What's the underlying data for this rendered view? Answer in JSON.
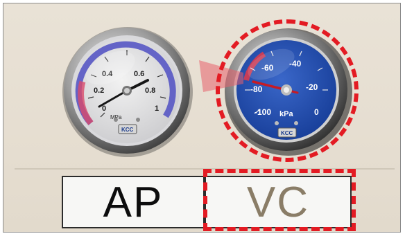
{
  "gauge_ap": {
    "unit": "MPa",
    "scale_labels": [
      "0",
      "0.2",
      "0.4",
      "0.6",
      "0.8",
      "1"
    ],
    "brand": "KCC"
  },
  "gauge_vc": {
    "unit": "kPa",
    "scale_labels": [
      "-100",
      "-80",
      "-60",
      "-40",
      "-20",
      "0"
    ],
    "brand": "KCC"
  },
  "labels": {
    "ap": "AP",
    "vc": "VC"
  },
  "colors": {
    "highlight": "#e31b23",
    "vacuum_face": "#1f4aa8",
    "pressure_band": "#4f4fbf",
    "ap_text": "#0d0d0d",
    "vc_text": "#8a7d67"
  }
}
